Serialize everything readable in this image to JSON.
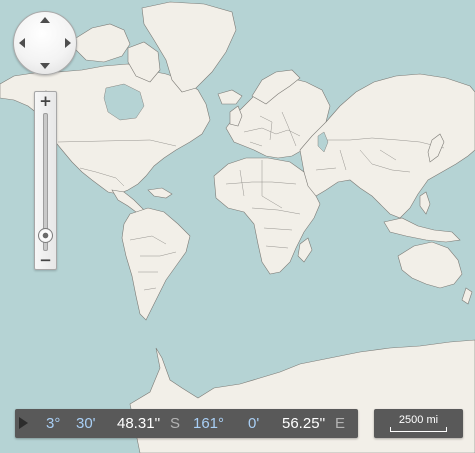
{
  "map": {
    "colors": {
      "water": "#b5d3d4",
      "land": "#f2efe8",
      "border": "#7d7b76"
    }
  },
  "navigation": {
    "icons": [
      "pan-up-icon",
      "pan-down-icon",
      "pan-left-icon",
      "pan-right-icon"
    ]
  },
  "zoom": {
    "in_label": "+",
    "out_label": "−",
    "level_fraction": 0.1
  },
  "coordinates": {
    "latitude": {
      "degrees": "3°",
      "minutes": "30'",
      "seconds": "48.31''",
      "hemisphere": "S"
    },
    "longitude": {
      "degrees": "161°",
      "minutes": "0'",
      "seconds": "56.25''",
      "hemisphere": "E"
    },
    "colors": {
      "panel": "#595959",
      "degrees_minutes": "#a9cff5",
      "seconds": "#ffffff",
      "hemisphere": "#b4b4b4"
    }
  },
  "scale": {
    "label": "2500 mi"
  }
}
